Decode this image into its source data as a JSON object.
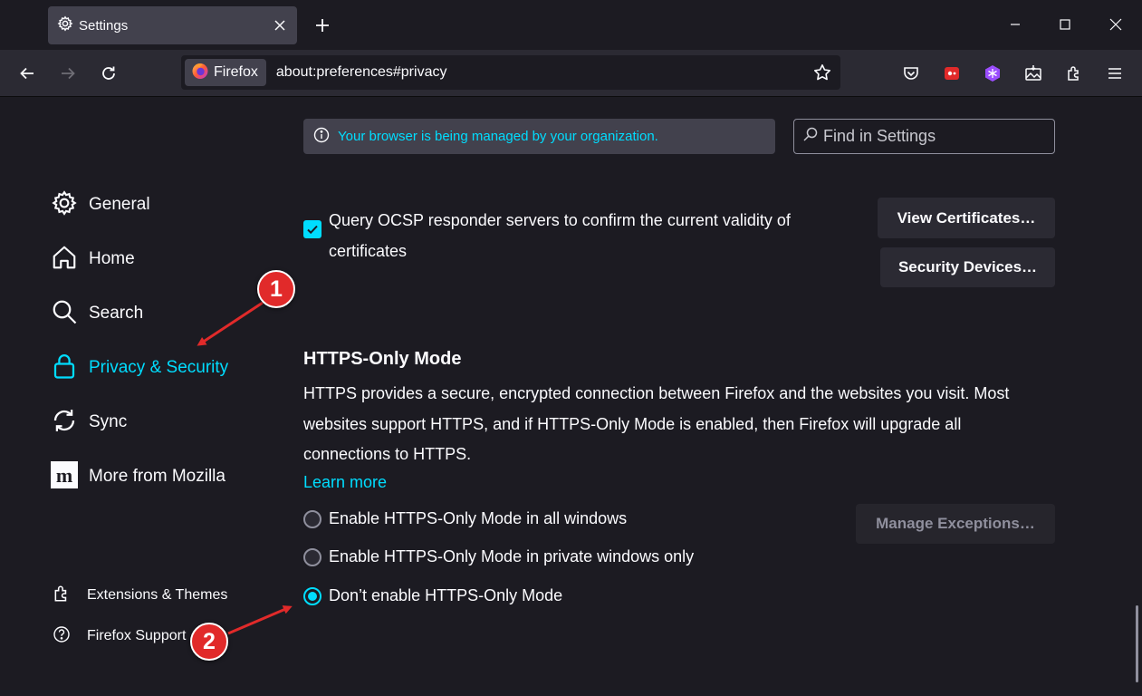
{
  "tab": {
    "title": "Settings"
  },
  "urlbar": {
    "identity_label": "Firefox",
    "url": "about:preferences#privacy"
  },
  "sidebar": {
    "categories": [
      {
        "label": "General",
        "icon": "gear-icon"
      },
      {
        "label": "Home",
        "icon": "home-icon"
      },
      {
        "label": "Search",
        "icon": "search-icon"
      },
      {
        "label": "Privacy & Security",
        "icon": "lock-icon",
        "selected": true
      },
      {
        "label": "Sync",
        "icon": "sync-icon"
      },
      {
        "label": "More from Mozilla",
        "icon": "mozilla-icon"
      }
    ],
    "footer": [
      {
        "label": "Extensions & Themes",
        "icon": "puzzle-icon"
      },
      {
        "label": "Firefox Support",
        "icon": "help-icon"
      }
    ]
  },
  "main": {
    "policies_notice": "Your browser is being managed by your organization.",
    "search_placeholder": "Find in Settings",
    "ocsp": {
      "label": "Query OCSP responder servers to confirm the current validity of certificates",
      "checked": true
    },
    "view_certificates_label": "View Certificates…",
    "security_devices_label": "Security Devices…",
    "https_only": {
      "heading": "HTTPS-Only Mode",
      "description": "HTTPS provides a secure, encrypted connection between Firefox and the websites you visit. Most websites support HTTPS, and if HTTPS-Only Mode is enabled, then Firefox will upgrade all connections to HTTPS.",
      "learn_more": "Learn more",
      "manage_exceptions_label": "Manage Exceptions…",
      "options": [
        {
          "label": "Enable HTTPS-Only Mode in all windows",
          "checked": false
        },
        {
          "label": "Enable HTTPS-Only Mode in private windows only",
          "checked": false
        },
        {
          "label": "Don’t enable HTTPS-Only Mode",
          "checked": true
        }
      ]
    }
  },
  "annotations": {
    "marker_1": "1",
    "marker_2": "2"
  },
  "colors": {
    "accent": "#00ddff",
    "background": "#1c1b22",
    "toolbar": "#2b2a33",
    "annotation": "#e12a2a"
  }
}
